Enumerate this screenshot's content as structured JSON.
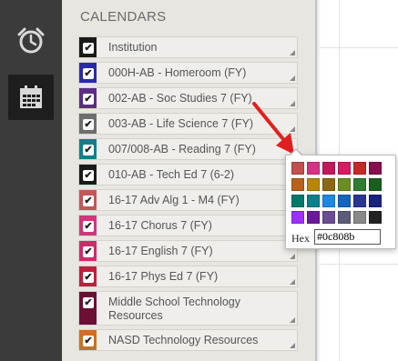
{
  "sidebar_nav": [
    {
      "name": "alarm-clock-icon",
      "active": false
    },
    {
      "name": "calendar-icon",
      "active": true
    }
  ],
  "panel": {
    "title": "CALENDARS"
  },
  "calendars": [
    {
      "label": "Institution",
      "color": "#1a1a1a",
      "checked": true
    },
    {
      "label": "000H-AB - Homeroom (FY)",
      "color": "#2a2aa8",
      "checked": true
    },
    {
      "label": "002-AB - Soc Studies 7 (FY)",
      "color": "#5b2d86",
      "checked": true
    },
    {
      "label": "003-AB - Life Science 7 (FY)",
      "color": "#6e6e6e",
      "checked": true
    },
    {
      "label": "007/008-AB - Reading 7 (FY)",
      "color": "#0c808b",
      "checked": true
    },
    {
      "label": "010-AB - Tech Ed 7 (6-2)",
      "color": "#1a1a1a",
      "checked": true
    },
    {
      "label": "16-17 Adv Alg 1 - M4 (FY)",
      "color": "#c2565a",
      "checked": true
    },
    {
      "label": "16-17 Chorus 7 (FY)",
      "color": "#c93a7a",
      "checked": true
    },
    {
      "label": "16-17 English 7 (FY)",
      "color": "#d12a6a",
      "checked": true
    },
    {
      "label": "16-17 Phys Ed 7 (FY)",
      "color": "#c21f3e",
      "checked": true
    },
    {
      "label": "Middle School Technology Resources",
      "color": "#6b0f35",
      "checked": true
    },
    {
      "label": "NASD Technology Resources",
      "color": "#c8731f",
      "checked": true
    }
  ],
  "color_picker": {
    "hex_label": "Hex",
    "hex_value": "#0c808b",
    "colors": [
      "#c0504d",
      "#d63384",
      "#c2185b",
      "#d81b60",
      "#c62828",
      "#880e4f",
      "#b8601c",
      "#b8860b",
      "#8b6914",
      "#6b8e23",
      "#2e7d32",
      "#1b5e20",
      "#00796b",
      "#0c808b",
      "#1e88e5",
      "#1565c0",
      "#283593",
      "#1a237e",
      "#9b30ff",
      "#6a1b9a",
      "#6a4c93",
      "#5c5c7a",
      "#888888",
      "#222222"
    ]
  }
}
